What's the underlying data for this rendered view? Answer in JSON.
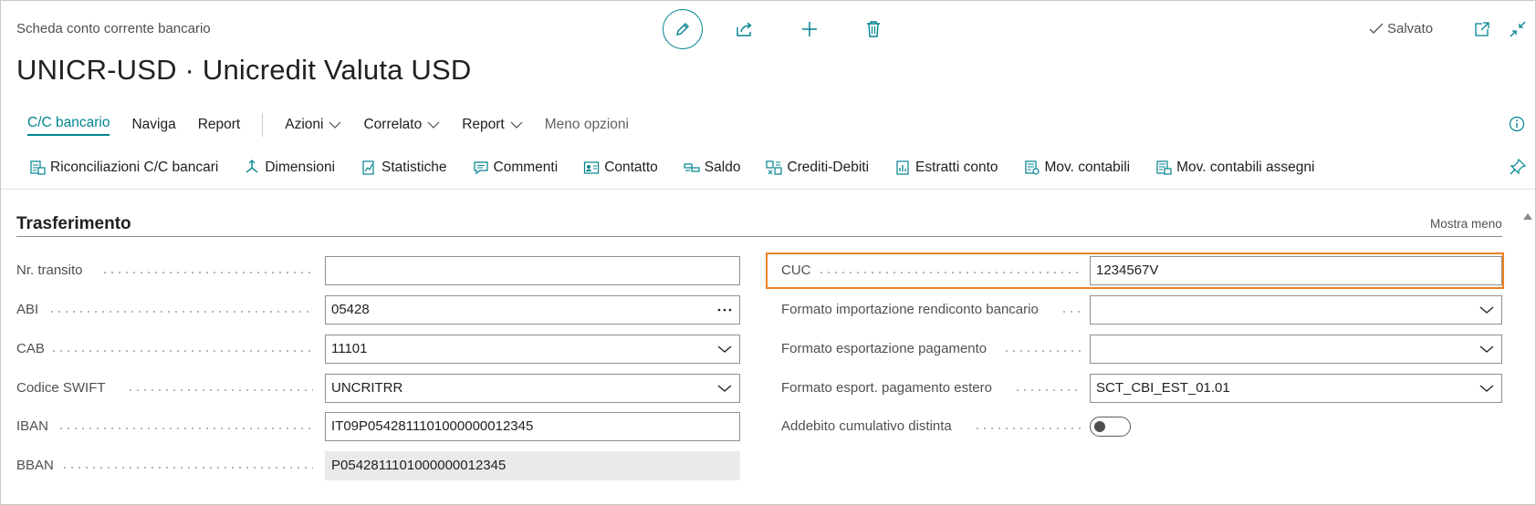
{
  "header": {
    "breadcrumb": "Scheda conto corrente bancario",
    "title": "UNICR-USD · Unicredit Valuta USD",
    "saved_status": "Salvato"
  },
  "nav": {
    "tabs": [
      "C/C bancario",
      "Naviga",
      "Report"
    ],
    "menus": [
      "Azioni",
      "Correlato",
      "Report"
    ],
    "less_options": "Meno opzioni"
  },
  "actions": [
    {
      "label": "Riconciliazioni C/C bancari",
      "icon": "reconciliation-icon"
    },
    {
      "label": "Dimensioni",
      "icon": "dimensions-icon"
    },
    {
      "label": "Statistiche",
      "icon": "statistics-icon"
    },
    {
      "label": "Commenti",
      "icon": "comments-icon"
    },
    {
      "label": "Contatto",
      "icon": "contact-icon"
    },
    {
      "label": "Saldo",
      "icon": "balance-icon"
    },
    {
      "label": "Crediti-Debiti",
      "icon": "receivables-payables-icon"
    },
    {
      "label": "Estratti conto",
      "icon": "statements-icon"
    },
    {
      "label": "Mov. contabili",
      "icon": "ledger-entries-icon"
    },
    {
      "label": "Mov. contabili assegni",
      "icon": "check-ledger-entries-icon"
    }
  ],
  "section": {
    "title": "Trasferimento",
    "show_less": "Mostra meno"
  },
  "left_fields": [
    {
      "label": "Nr. transito",
      "value": ""
    },
    {
      "label": "ABI",
      "value": "05428"
    },
    {
      "label": "CAB",
      "value": "11101"
    },
    {
      "label": "Codice SWIFT",
      "value": "UNCRITRR"
    },
    {
      "label": "IBAN",
      "value": "IT09P0542811101000000012345"
    },
    {
      "label": "BBAN",
      "value": "P0542811101000000012345"
    }
  ],
  "right_fields": [
    {
      "label": "CUC",
      "value": "1234567V"
    },
    {
      "label": "Formato importazione rendiconto bancario",
      "value": ""
    },
    {
      "label": "Formato esportazione pagamento",
      "value": ""
    },
    {
      "label": "Formato esport. pagamento estero",
      "value": "SCT_CBI_EST_01.01"
    },
    {
      "label": "Addebito cumulativo distinta",
      "value": false
    }
  ],
  "colors": {
    "accent": "#00838f",
    "highlight": "#f0801e"
  }
}
